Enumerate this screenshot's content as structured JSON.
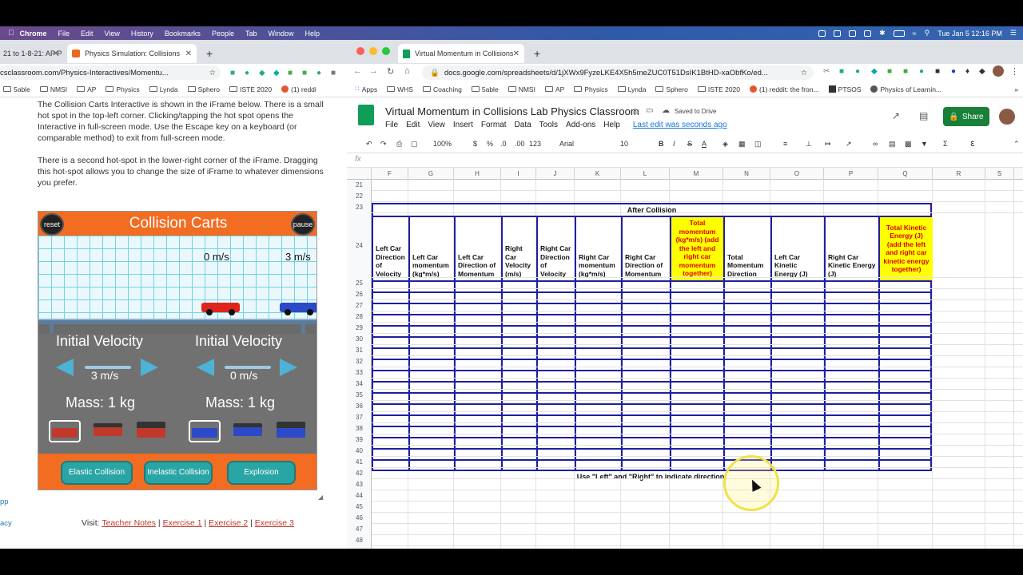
{
  "menubar": {
    "app": "Chrome",
    "items": [
      "File",
      "Edit",
      "View",
      "History",
      "Bookmarks",
      "People",
      "Tab",
      "Window",
      "Help"
    ],
    "datetime": "Tue Jan 5  12:16 PM"
  },
  "left_window": {
    "tab1": "21 to 1-8-21: AP P",
    "tab2": "Physics Simulation: Collisions",
    "url": "csclassroom.com/Physics-Interactives/Momentu...",
    "bookmarks": [
      "5able",
      "NMSI",
      "AP",
      "Physics",
      "Lynda",
      "Sphero",
      "ISTE 2020",
      "(1) reddi"
    ],
    "para1": "The Collision Carts Interactive is shown in the iFrame below. There is a small hot spot in the top-left corner. Clicking/tapping the hot spot opens the Interactive in full-screen mode. Use the Escape key on a keyboard (or comparable method) to exit from full-screen mode.",
    "para2": "There is a second hot-spot in the lower-right corner of the iFrame. Dragging this hot-spot allows you to change the size of iFrame to whatever dimensions you prefer.",
    "sim": {
      "title": "Collision Carts",
      "reset": "reset",
      "pause": "pause",
      "left_speed": "0 m/s",
      "right_speed": "3 m/s",
      "iv_left_label": "Initial Velocity",
      "iv_right_label": "Initial Velocity",
      "iv_left_value": "3 m/s",
      "iv_right_value": "0 m/s",
      "mass_left": "Mass: 1 kg",
      "mass_right": "Mass: 1 kg",
      "btn_elastic": "Elastic Collision",
      "btn_inelastic": "Inelastic Collision",
      "btn_explosion": "Explosion",
      "left_car_color": "#e0241b",
      "right_car_color": "#2b49c8"
    },
    "visit_prefix": "Visit:",
    "visit_links": [
      "Teacher Notes",
      "Exercise 1",
      "Exercise 2",
      "Exercise 3"
    ],
    "side_items": [
      "pp",
      "acy"
    ]
  },
  "right_window": {
    "tab": "Virtual Momentum in Collisions",
    "url": "docs.google.com/spreadsheets/d/1jXWx9FyzeLKE4X5h5meZUC0T51DsIK1BtHD-xaObfKo/ed...",
    "bookmarks": [
      "Apps",
      "WHS",
      "Coaching",
      "5able",
      "NMSI",
      "AP",
      "Physics",
      "Lynda",
      "Sphero",
      "ISTE 2020",
      "(1) reddit: the fron...",
      "PTSOS",
      "Physics of Learnin..."
    ],
    "doc_title": "Virtual Momentum in Collisions Lab Physics Classroom",
    "saved": "Saved to Drive",
    "menus": [
      "File",
      "Edit",
      "View",
      "Insert",
      "Format",
      "Data",
      "Tools",
      "Add-ons",
      "Help"
    ],
    "last_edit": "Last edit was seconds ago",
    "share": "Share",
    "toolbar": {
      "zoom": "100%",
      "dollar": "$",
      "pct": "%",
      "dec0": ".0",
      "dec00": ".00",
      "fmt123": "123",
      "font": "Arial",
      "size": "10"
    },
    "fx": "fx",
    "columns": [
      "F",
      "G",
      "H",
      "I",
      "J",
      "K",
      "L",
      "M",
      "N",
      "O",
      "P",
      "Q",
      "R",
      "S"
    ],
    "rows": [
      "21",
      "22",
      "23",
      "24",
      "25",
      "26",
      "27",
      "28",
      "29",
      "30",
      "31",
      "32",
      "33",
      "34",
      "35",
      "36",
      "37",
      "38",
      "39",
      "40",
      "41",
      "42",
      "43",
      "44",
      "45",
      "46",
      "47",
      "48"
    ],
    "after_collision": "After Collision",
    "headers": [
      "Left Car Direction of Velocity",
      "Left Car momentum (kg*m/s)",
      "Left Car Direction of Momentum",
      "Right Car Velocity (m/s)",
      "Right Car Direction of Velocity",
      "Right Car momentum (kg*m/s)",
      "Right Car Direction of Momentum",
      "Total momentum (kg*m/s) (add the left and right car momentum together)",
      "Total Momentum Direction",
      "Left Car Kinetic Energy (J)",
      "Right Car Kinetic Energy (J)",
      "Total Kinetic Energy (J) (add the left and right car kinetic energy together)"
    ],
    "instruction": "Use \"Left\" and \"Right\" to indicate direction!",
    "highlight_color": "#ffff00",
    "border_color": "#1f1fa0"
  }
}
